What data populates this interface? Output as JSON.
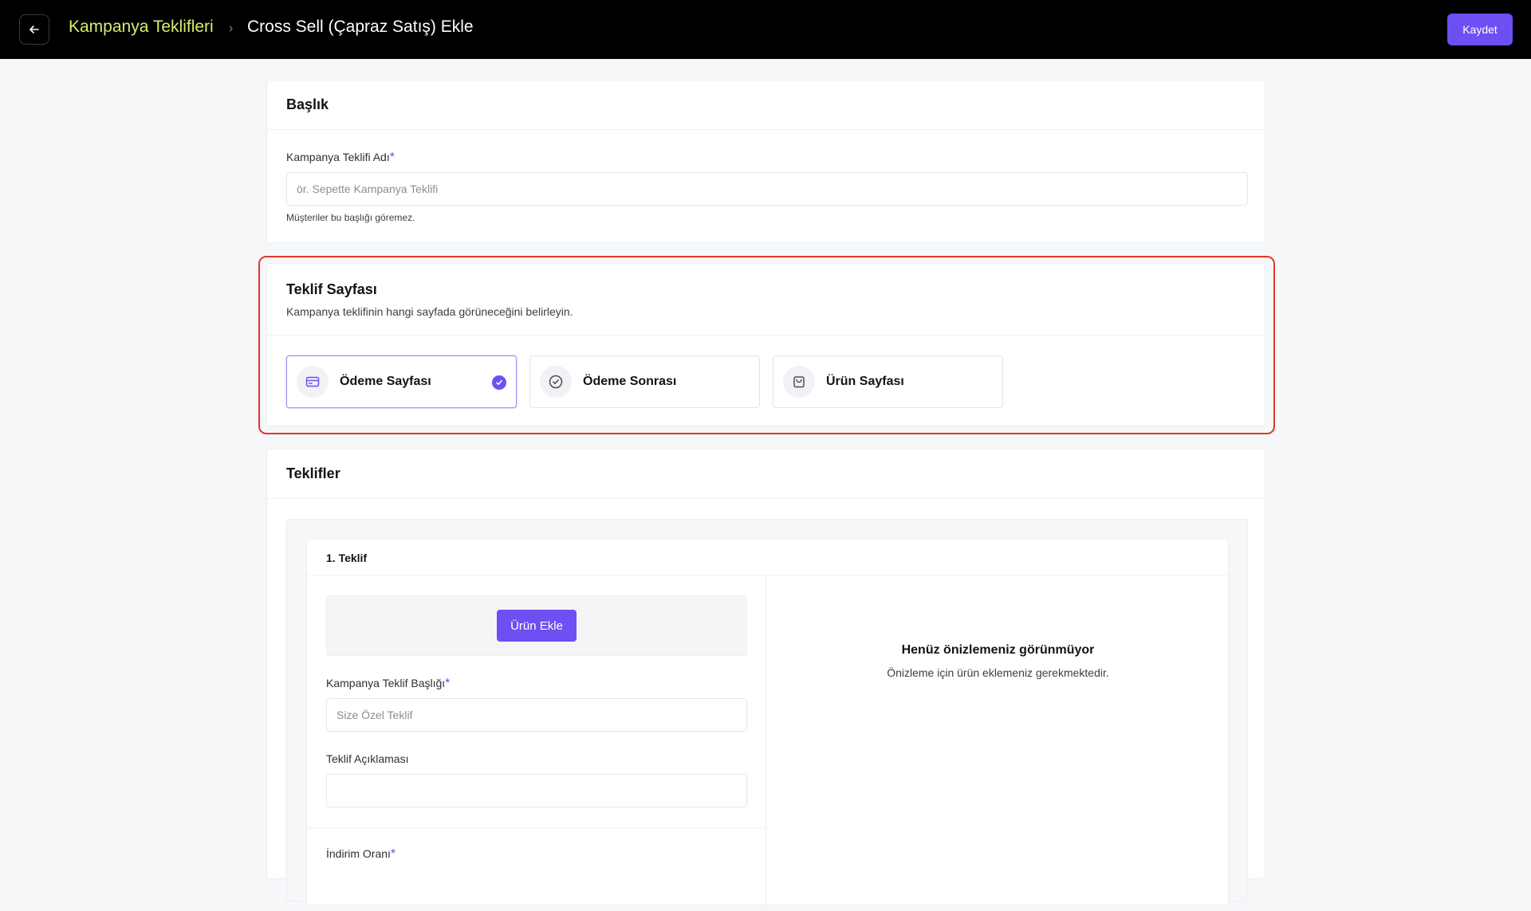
{
  "header": {
    "breadcrumb_link": "Kampanya Teklifleri",
    "breadcrumb_separator": "›",
    "page_title": "Cross Sell (Çapraz Satış) Ekle",
    "save_label": "Kaydet"
  },
  "title_section": {
    "heading": "Başlık",
    "name_label": "Kampanya Teklifi Adı",
    "required_mark": "*",
    "name_placeholder": "ör. Sepette Kampanya Teklifi",
    "help": "Müşteriler bu başlığı göremez."
  },
  "page_section": {
    "heading": "Teklif Sayfası",
    "description": "Kampanya teklifinin hangi sayfada görüneceğini belirleyin.",
    "options": [
      {
        "label": "Ödeme Sayfası",
        "icon": "credit-card-icon",
        "selected": true
      },
      {
        "label": "Ödeme Sonrası",
        "icon": "check-circle-icon",
        "selected": false
      },
      {
        "label": "Ürün Sayfası",
        "icon": "shopping-bag-icon",
        "selected": false
      }
    ]
  },
  "offers_section": {
    "heading": "Teklifler",
    "offer": {
      "title": "1. Teklif",
      "add_product_label": "Ürün Ekle",
      "offer_title_label": "Kampanya Teklif Başlığı",
      "offer_title_placeholder": "Size Özel Teklif",
      "description_label": "Teklif Açıklaması",
      "description_value": "",
      "discount_label": "İndirim Oranı",
      "required_mark": "*",
      "preview_title": "Henüz önizlemeniz görünmüyor",
      "preview_text": "Önizleme için ürün eklemeniz gerekmektedir."
    }
  },
  "colors": {
    "accent": "#6d4ff2",
    "breadcrumb_link": "#d8ec6e",
    "highlight": "#e2372b",
    "topbar": "#000000"
  }
}
